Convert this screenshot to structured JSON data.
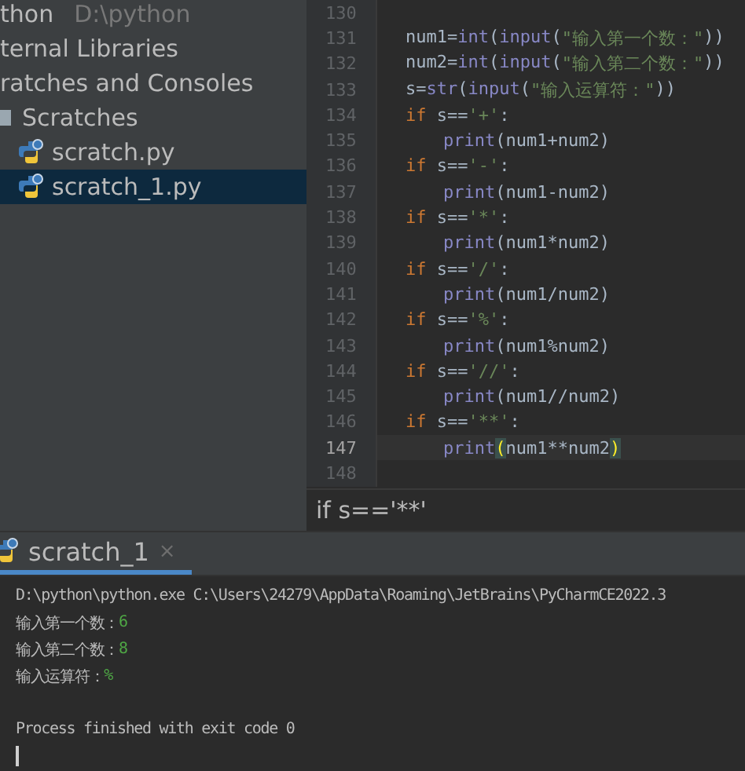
{
  "project_tree": [
    {
      "label": "thon",
      "path": "D:\\python",
      "selected": false
    },
    {
      "label": "ternal Libraries",
      "selected": false
    },
    {
      "label": "ratches and Consoles",
      "selected": false
    },
    {
      "label": "Scratches",
      "selected": false,
      "children": [
        {
          "label": "scratch.py",
          "selected": false
        },
        {
          "label": "scratch_1.py",
          "selected": true
        }
      ]
    }
  ],
  "editor": {
    "lines": [
      {
        "number": "130",
        "current": false
      },
      {
        "number": "131",
        "current": false,
        "indent": false,
        "segments": [
          {
            "kind": "plain",
            "text": "num1="
          },
          {
            "kind": "fn",
            "text": "int"
          },
          {
            "kind": "plain",
            "text": "("
          },
          {
            "kind": "fn",
            "text": "input"
          },
          {
            "kind": "plain",
            "text": "("
          },
          {
            "kind": "str",
            "text": "\"输入第一个数：\""
          },
          {
            "kind": "plain",
            "text": "))"
          }
        ]
      },
      {
        "number": "132",
        "current": false,
        "indent": false,
        "segments": [
          {
            "kind": "plain",
            "text": "num2="
          },
          {
            "kind": "fn",
            "text": "int"
          },
          {
            "kind": "plain",
            "text": "("
          },
          {
            "kind": "fn",
            "text": "input"
          },
          {
            "kind": "plain",
            "text": "("
          },
          {
            "kind": "str",
            "text": "\"输入第二个数：\""
          },
          {
            "kind": "plain",
            "text": "))"
          }
        ]
      },
      {
        "number": "133",
        "current": false,
        "indent": false,
        "segments": [
          {
            "kind": "plain",
            "text": "s="
          },
          {
            "kind": "fn",
            "text": "str"
          },
          {
            "kind": "plain",
            "text": "("
          },
          {
            "kind": "fn",
            "text": "input"
          },
          {
            "kind": "plain",
            "text": "("
          },
          {
            "kind": "str",
            "text": "\"输入运算符：\""
          },
          {
            "kind": "plain",
            "text": "))"
          }
        ]
      },
      {
        "number": "134",
        "current": false,
        "indent": false,
        "segments": [
          {
            "kind": "kw",
            "text": "if "
          },
          {
            "kind": "plain",
            "text": "s=="
          },
          {
            "kind": "str",
            "text": "'+'"
          },
          {
            "kind": "plain",
            "text": ":"
          }
        ]
      },
      {
        "number": "135",
        "current": false,
        "indent": true,
        "segments": [
          {
            "kind": "fn",
            "text": "print"
          },
          {
            "kind": "plain",
            "text": "(num1+num2)"
          }
        ]
      },
      {
        "number": "136",
        "current": false,
        "indent": false,
        "segments": [
          {
            "kind": "kw",
            "text": "if "
          },
          {
            "kind": "plain",
            "text": "s=="
          },
          {
            "kind": "str",
            "text": "'-'"
          },
          {
            "kind": "plain",
            "text": ":"
          }
        ]
      },
      {
        "number": "137",
        "current": false,
        "indent": true,
        "segments": [
          {
            "kind": "fn",
            "text": "print"
          },
          {
            "kind": "plain",
            "text": "(num1-num2)"
          }
        ]
      },
      {
        "number": "138",
        "current": false,
        "indent": false,
        "segments": [
          {
            "kind": "kw",
            "text": "if "
          },
          {
            "kind": "plain",
            "text": "s=="
          },
          {
            "kind": "str",
            "text": "'*'"
          },
          {
            "kind": "plain",
            "text": ":"
          }
        ]
      },
      {
        "number": "139",
        "current": false,
        "indent": true,
        "segments": [
          {
            "kind": "fn",
            "text": "print"
          },
          {
            "kind": "plain",
            "text": "(num1*num2)"
          }
        ]
      },
      {
        "number": "140",
        "current": false,
        "indent": false,
        "segments": [
          {
            "kind": "kw",
            "text": "if "
          },
          {
            "kind": "plain",
            "text": "s=="
          },
          {
            "kind": "str",
            "text": "'/'"
          },
          {
            "kind": "plain",
            "text": ":"
          }
        ]
      },
      {
        "number": "141",
        "current": false,
        "indent": true,
        "segments": [
          {
            "kind": "fn",
            "text": "print"
          },
          {
            "kind": "plain",
            "text": "(num1/num2)"
          }
        ]
      },
      {
        "number": "142",
        "current": false,
        "indent": false,
        "segments": [
          {
            "kind": "kw",
            "text": "if "
          },
          {
            "kind": "plain",
            "text": "s=="
          },
          {
            "kind": "str",
            "text": "'%'"
          },
          {
            "kind": "plain",
            "text": ":"
          }
        ]
      },
      {
        "number": "143",
        "current": false,
        "indent": true,
        "segments": [
          {
            "kind": "fn",
            "text": "print"
          },
          {
            "kind": "plain",
            "text": "(num1%num2)"
          }
        ]
      },
      {
        "number": "144",
        "current": false,
        "indent": false,
        "segments": [
          {
            "kind": "kw",
            "text": "if "
          },
          {
            "kind": "plain",
            "text": "s=="
          },
          {
            "kind": "str",
            "text": "'//'"
          },
          {
            "kind": "plain",
            "text": ":"
          }
        ]
      },
      {
        "number": "145",
        "current": false,
        "indent": true,
        "segments": [
          {
            "kind": "fn",
            "text": "print"
          },
          {
            "kind": "plain",
            "text": "(num1//num2)"
          }
        ]
      },
      {
        "number": "146",
        "current": false,
        "indent": false,
        "segments": [
          {
            "kind": "kw",
            "text": "if "
          },
          {
            "kind": "plain",
            "text": "s=="
          },
          {
            "kind": "str",
            "text": "'**'"
          },
          {
            "kind": "plain",
            "text": ":"
          }
        ]
      },
      {
        "number": "147",
        "current": true,
        "indent": true,
        "segments": [
          {
            "kind": "fn",
            "text": "print"
          },
          {
            "kind": "match",
            "text": "("
          },
          {
            "kind": "plain",
            "text": "num1**num2"
          },
          {
            "kind": "match",
            "text": ")"
          }
        ]
      },
      {
        "number": "148",
        "current": false
      }
    ],
    "breadcrumb": "if s=='**'"
  },
  "run_panel": {
    "tabs": [
      {
        "label": "scratch_1",
        "selected": true,
        "close": "×"
      }
    ],
    "console": [
      {
        "kind": "text",
        "segments": [
          {
            "kind": "out",
            "text": "D:\\python\\python.exe C:\\Users\\24279\\AppData\\Roaming\\JetBrains\\PyCharmCE2022.3"
          }
        ]
      },
      {
        "kind": "text",
        "segments": [
          {
            "kind": "out",
            "text": "输入第一个数："
          },
          {
            "kind": "input",
            "text": "6"
          }
        ]
      },
      {
        "kind": "text",
        "segments": [
          {
            "kind": "out",
            "text": "输入第二个数："
          },
          {
            "kind": "input",
            "text": "8"
          }
        ]
      },
      {
        "kind": "text",
        "segments": [
          {
            "kind": "out",
            "text": "输入运算符："
          },
          {
            "kind": "input",
            "text": "%"
          }
        ]
      },
      {
        "kind": "blank"
      },
      {
        "kind": "text",
        "segments": [
          {
            "kind": "out",
            "text": "Process finished with exit code 0"
          }
        ]
      }
    ],
    "cursor": true
  }
}
